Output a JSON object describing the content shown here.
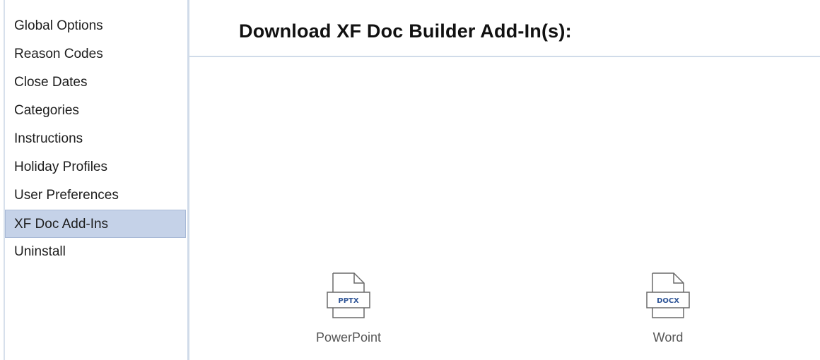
{
  "sidebar": {
    "items": [
      {
        "label": "Global Options",
        "selected": false
      },
      {
        "label": "Reason Codes",
        "selected": false
      },
      {
        "label": "Close Dates",
        "selected": false
      },
      {
        "label": "Categories",
        "selected": false
      },
      {
        "label": "Instructions",
        "selected": false
      },
      {
        "label": "Holiday Profiles",
        "selected": false
      },
      {
        "label": "User Preferences",
        "selected": false
      },
      {
        "label": "XF Doc Add-Ins",
        "selected": true
      },
      {
        "label": "Uninstall",
        "selected": false
      }
    ]
  },
  "main": {
    "title": "Download XF Doc Builder Add-In(s):",
    "addins": [
      {
        "label": "PowerPoint",
        "badge": "PPTX",
        "icon": "pptx-file-icon"
      },
      {
        "label": "Word",
        "badge": "DOCX",
        "icon": "docx-file-icon"
      }
    ]
  },
  "colors": {
    "selected_bg": "#c5d2e8",
    "divider": "#d0dbe9",
    "badge_text": "#2f5597"
  }
}
